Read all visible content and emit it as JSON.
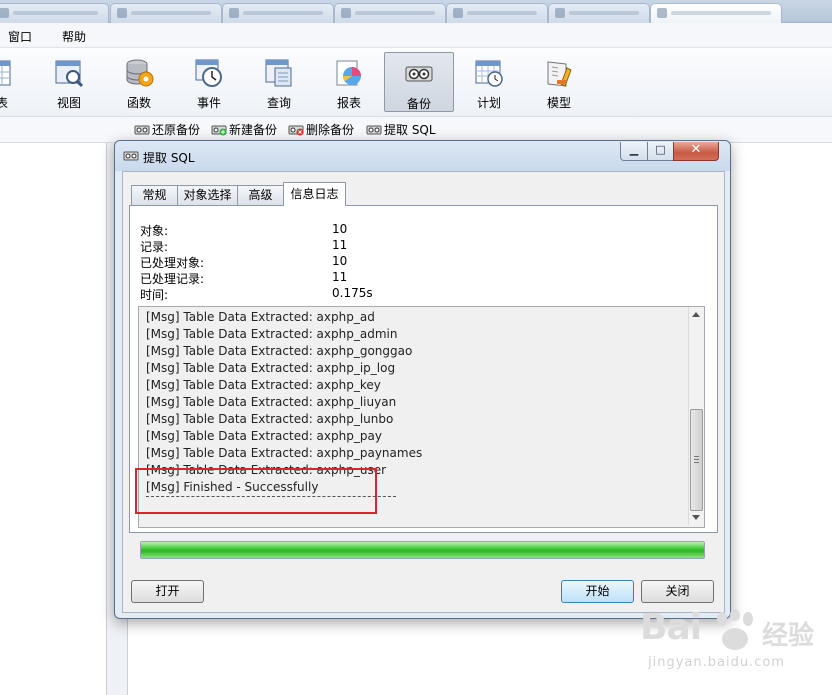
{
  "menubar": {
    "items": [
      "窗口",
      "帮助"
    ]
  },
  "toolbar": {
    "items": [
      {
        "label": "表",
        "icon": "table-icon"
      },
      {
        "label": "视图",
        "icon": "view-icon"
      },
      {
        "label": "函数",
        "icon": "function-icon"
      },
      {
        "label": "事件",
        "icon": "event-icon"
      },
      {
        "label": "查询",
        "icon": "query-icon"
      },
      {
        "label": "报表",
        "icon": "report-icon"
      },
      {
        "label": "备份",
        "icon": "backup-icon",
        "active": true
      },
      {
        "label": "计划",
        "icon": "schedule-icon"
      },
      {
        "label": "模型",
        "icon": "model-icon"
      }
    ]
  },
  "subbar": {
    "restore": "还原备份",
    "new": "新建备份",
    "delete": "删除备份",
    "extract": "提取 SQL"
  },
  "dialog": {
    "title": "提取 SQL",
    "tabs": [
      "常规",
      "对象选择",
      "高级",
      "信息日志"
    ],
    "active_tab": "信息日志",
    "stats": [
      {
        "label": "对象:",
        "value": "10"
      },
      {
        "label": "记录:",
        "value": "11"
      },
      {
        "label": "已处理对象:",
        "value": "10"
      },
      {
        "label": "已处理记录:",
        "value": "11"
      },
      {
        "label": "时间:",
        "value": "0.175s"
      }
    ],
    "log": [
      "[Msg] Table Data Extracted: axphp_ad",
      "[Msg] Table Data Extracted: axphp_admin",
      "[Msg] Table Data Extracted: axphp_gonggao",
      "[Msg] Table Data Extracted: axphp_ip_log",
      "[Msg] Table Data Extracted: axphp_key",
      "[Msg] Table Data Extracted: axphp_liuyan",
      "[Msg] Table Data Extracted: axphp_lunbo",
      "[Msg] Table Data Extracted: axphp_pay",
      "[Msg] Table Data Extracted: axphp_paynames",
      "[Msg] Table Data Extracted: axphp_user",
      "[Msg] Finished - Successfully"
    ],
    "progress": 1.0,
    "buttons": {
      "open": "打开",
      "start": "开始",
      "close": "关闭"
    }
  },
  "watermark": {
    "logo": "Bai",
    "text": "经验",
    "url": "jingyan.baidu.com"
  },
  "colors": {
    "progress": "#37c62d",
    "highlight": "#d9262b",
    "accent": "#3c7fb1"
  }
}
